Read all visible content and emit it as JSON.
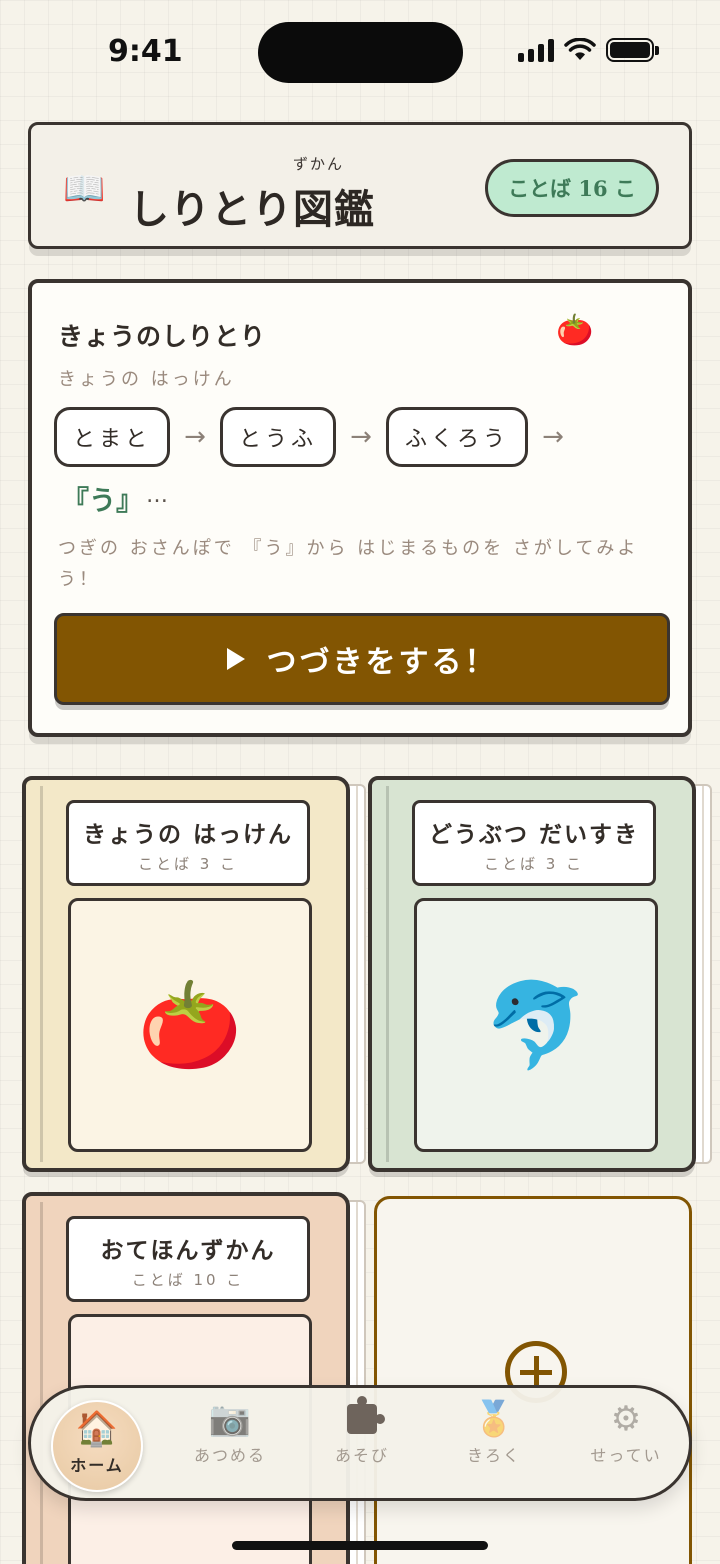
{
  "status_bar": {
    "time": "9:41"
  },
  "header": {
    "icon": "open-book-icon",
    "title": "しりとり図鑑",
    "ruby": "ずかん",
    "badge": "ことば 16 こ"
  },
  "today": {
    "title": "きょうのしりとり",
    "icon": "tomato-icon",
    "subtitle": "きょうの はっけん",
    "chain": [
      "とまと",
      "とうふ",
      "ふくろう"
    ],
    "next_char": "『う』",
    "next_dots": "…",
    "hint": "つぎの おさんぽで 『う』から はじまるものを さがしてみよう！",
    "button": "つづきをする！"
  },
  "books": [
    {
      "title": "きょうの はっけん",
      "count": "ことば 3 こ",
      "icon": "tomato-icon",
      "emoji": "🍅"
    },
    {
      "title": "どうぶつ だいすき",
      "count": "ことば 3 こ",
      "icon": "dolphin-icon",
      "emoji": "🐬"
    },
    {
      "title": "おてほんずかん",
      "count": "ことば 10 こ",
      "icon": "",
      "emoji": ""
    }
  ],
  "add_book": {
    "icon": "plus-circle-icon"
  },
  "tabs": [
    {
      "label": "ホーム",
      "icon": "house-icon",
      "active": true
    },
    {
      "label": "あつめる",
      "icon": "camera-icon"
    },
    {
      "label": "あそび",
      "icon": "puzzle-icon"
    },
    {
      "label": "きろく",
      "icon": "medal-icon"
    },
    {
      "label": "せってい",
      "icon": "gear-icon"
    }
  ],
  "colors": {
    "accent_brown": "#825502",
    "badge_green": "#bfead0",
    "text_green": "#3e7a58",
    "outline": "#3a3430"
  }
}
